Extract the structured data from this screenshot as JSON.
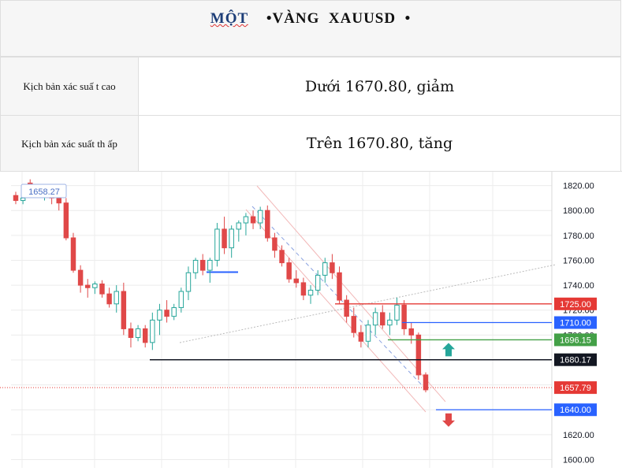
{
  "header": {
    "title_part1": "MỘT",
    "title_part2": "•VÀNG  XAUUSD  •"
  },
  "scenarios": [
    {
      "label": "Kịch bản xác suấ t cao",
      "value": "Dưới 1670.80, giảm"
    },
    {
      "label": "Kịch bản xác suất th ấp",
      "value": "Trên 1670.80, tăng"
    }
  ],
  "colors": {
    "up": "#26a69a",
    "down": "#e04848",
    "grid": "#ececec",
    "blue": "#2962ff",
    "green": "#43a047",
    "red": "#e53935",
    "black": "#131722"
  },
  "chart_data": {
    "type": "candlestick",
    "symbol": "XAUUSD",
    "ylim": [
      1600,
      1820
    ],
    "y_ticks": [
      1600,
      1620,
      1640,
      1660,
      1680,
      1700,
      1720,
      1740,
      1760,
      1780,
      1800,
      1820
    ],
    "y_tick_labels": [
      "1600.00",
      "1620.00",
      "1640.00",
      "1660.00",
      "1680.00",
      "1700.00",
      "1720.00",
      "1740.00",
      "1760.00",
      "1780.00",
      "1800.00",
      "1820.00"
    ],
    "levels": [
      {
        "label": "1725.00",
        "value": 1725.0,
        "color": "#e53935"
      },
      {
        "label": "1710.00",
        "value": 1710.0,
        "color": "#2962ff"
      },
      {
        "label": "1696.15",
        "value": 1696.15,
        "color": "#43a047"
      },
      {
        "label": "1680.17",
        "value": 1680.17,
        "color": "#131722"
      },
      {
        "label": "1657.79",
        "value": 1657.79,
        "color": "#e53935"
      },
      {
        "label": "1640.00",
        "value": 1640.0,
        "color": "#2962ff"
      }
    ],
    "price_tag": {
      "label": "1658.27",
      "value": 1658.27
    },
    "current_price": 1657.79,
    "arrows": [
      {
        "direction": "up",
        "value": 1688,
        "color": "#26a69a"
      },
      {
        "direction": "down",
        "value": 1632,
        "color": "#e04848"
      }
    ],
    "candles": [
      [
        1812,
        1815,
        1805,
        1808
      ],
      [
        1808,
        1812,
        1805,
        1810
      ],
      [
        1822,
        1825,
        1812,
        1816
      ],
      [
        1816,
        1818,
        1810,
        1812
      ],
      [
        1812,
        1816,
        1808,
        1814
      ],
      [
        1814,
        1820,
        1805,
        1810
      ],
      [
        1810,
        1813,
        1800,
        1806
      ],
      [
        1806,
        1810,
        1776,
        1778
      ],
      [
        1778,
        1782,
        1750,
        1752
      ],
      [
        1752,
        1756,
        1734,
        1740
      ],
      [
        1740,
        1745,
        1730,
        1738
      ],
      [
        1738,
        1743,
        1733,
        1741
      ],
      [
        1741,
        1744,
        1730,
        1733
      ],
      [
        1733,
        1738,
        1722,
        1725
      ],
      [
        1725,
        1740,
        1718,
        1735
      ],
      [
        1735,
        1742,
        1700,
        1705
      ],
      [
        1705,
        1710,
        1690,
        1698
      ],
      [
        1698,
        1708,
        1695,
        1705
      ],
      [
        1705,
        1708,
        1690,
        1694
      ],
      [
        1694,
        1718,
        1688,
        1712
      ],
      [
        1712,
        1725,
        1700,
        1720
      ],
      [
        1720,
        1728,
        1710,
        1715
      ],
      [
        1715,
        1725,
        1712,
        1722
      ],
      [
        1722,
        1738,
        1718,
        1735
      ],
      [
        1735,
        1755,
        1728,
        1750
      ],
      [
        1750,
        1762,
        1745,
        1760
      ],
      [
        1760,
        1765,
        1748,
        1752
      ],
      [
        1752,
        1762,
        1742,
        1760
      ],
      [
        1760,
        1790,
        1755,
        1785
      ],
      [
        1785,
        1795,
        1765,
        1770
      ],
      [
        1770,
        1788,
        1762,
        1785
      ],
      [
        1785,
        1792,
        1775,
        1790
      ],
      [
        1790,
        1798,
        1780,
        1795
      ],
      [
        1795,
        1800,
        1785,
        1790
      ],
      [
        1790,
        1803,
        1785,
        1800
      ],
      [
        1800,
        1804,
        1775,
        1778
      ],
      [
        1778,
        1782,
        1762,
        1768
      ],
      [
        1768,
        1772,
        1755,
        1758
      ],
      [
        1758,
        1762,
        1742,
        1745
      ],
      [
        1745,
        1752,
        1738,
        1742
      ],
      [
        1742,
        1746,
        1728,
        1732
      ],
      [
        1732,
        1740,
        1725,
        1736
      ],
      [
        1736,
        1752,
        1732,
        1748
      ],
      [
        1748,
        1762,
        1742,
        1758
      ],
      [
        1758,
        1765,
        1745,
        1750
      ],
      [
        1750,
        1755,
        1725,
        1728
      ],
      [
        1728,
        1732,
        1710,
        1715
      ],
      [
        1715,
        1722,
        1698,
        1702
      ],
      [
        1702,
        1708,
        1690,
        1695
      ],
      [
        1695,
        1712,
        1690,
        1708
      ],
      [
        1708,
        1722,
        1700,
        1718
      ],
      [
        1718,
        1724,
        1705,
        1708
      ],
      [
        1708,
        1718,
        1700,
        1712
      ],
      [
        1712,
        1730,
        1708,
        1724
      ],
      [
        1724,
        1728,
        1700,
        1705
      ],
      [
        1705,
        1710,
        1693,
        1700
      ],
      [
        1700,
        1702,
        1664,
        1668
      ],
      [
        1668,
        1670,
        1654,
        1656
      ]
    ]
  }
}
